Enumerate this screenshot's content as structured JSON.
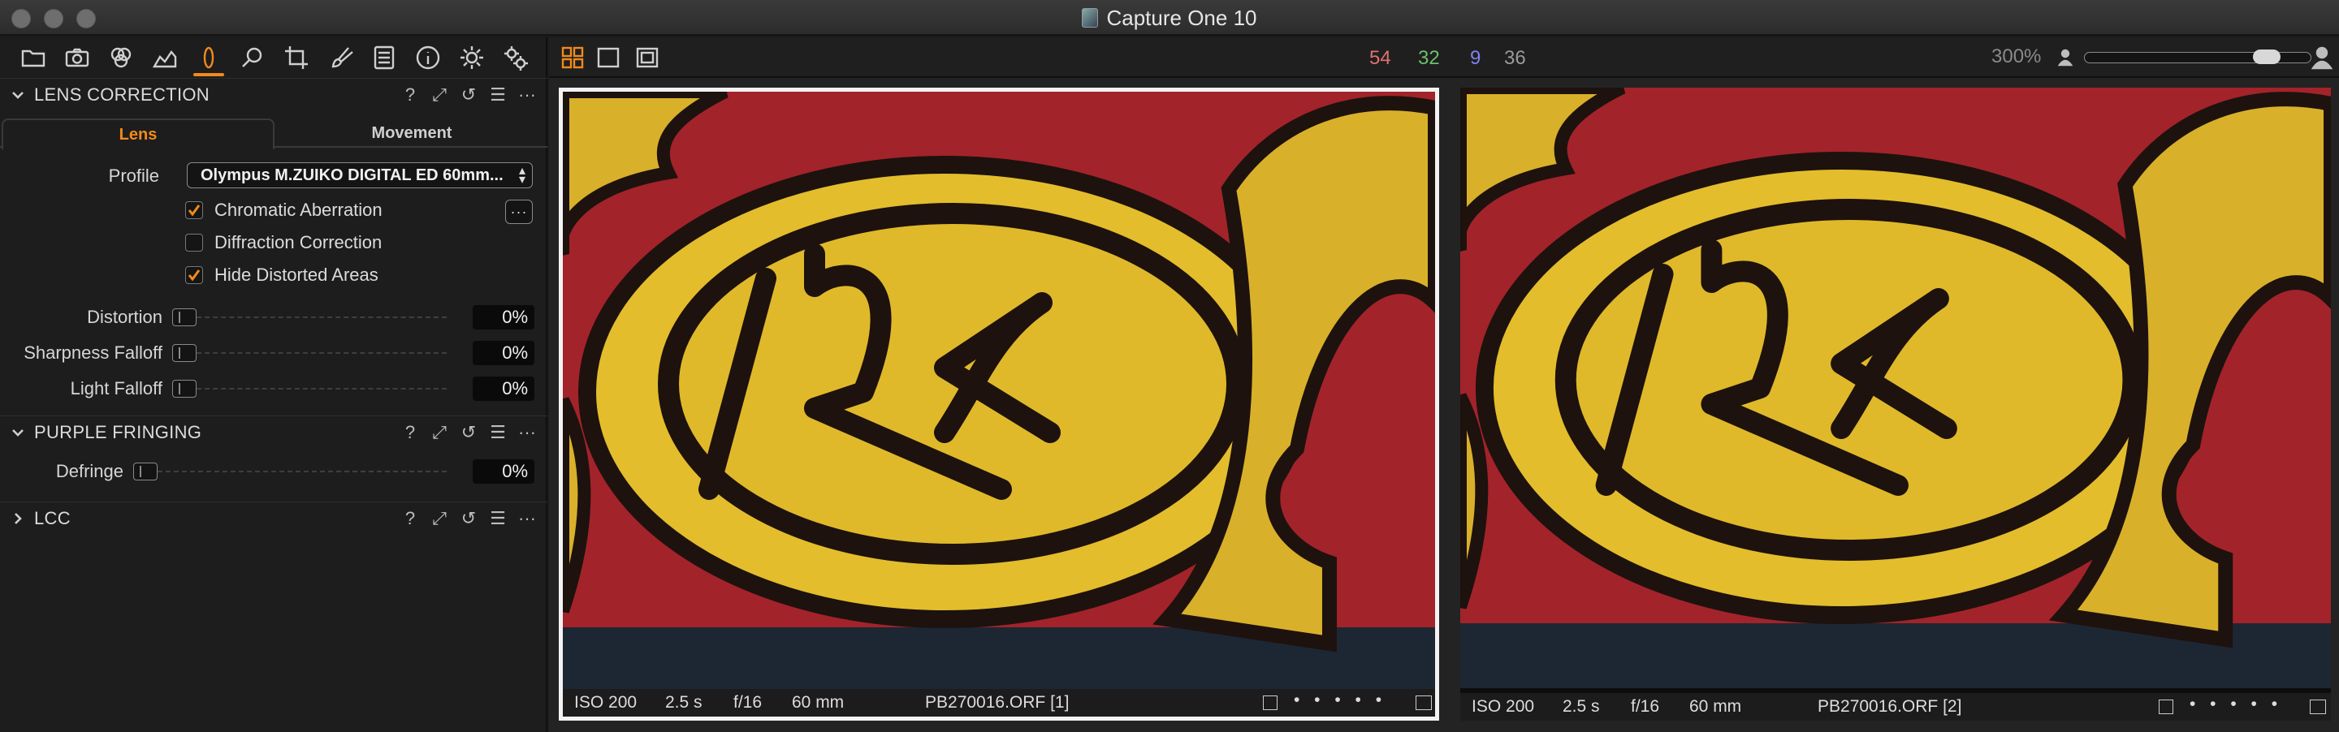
{
  "window": {
    "title": "Capture One 10",
    "colors": {
      "accent": "#f08a1c",
      "background": "#1b1b1b"
    }
  },
  "tool_tabs": [
    {
      "name": "library-icon"
    },
    {
      "name": "camera-icon"
    },
    {
      "name": "color-icon"
    },
    {
      "name": "exposure-icon"
    },
    {
      "name": "lens-icon",
      "active": true
    },
    {
      "name": "focus-icon"
    },
    {
      "name": "crop-icon"
    },
    {
      "name": "brush-icon"
    },
    {
      "name": "output-icon"
    },
    {
      "name": "metadata-icon"
    },
    {
      "name": "settings-icon"
    },
    {
      "name": "batch-icon"
    }
  ],
  "lens_correction": {
    "title": "LENS CORRECTION",
    "tools": [
      "?",
      "⤢",
      "↺",
      "☰",
      "···"
    ],
    "tabs": {
      "lens": "Lens",
      "movement": "Movement"
    },
    "profile_label": "Profile",
    "profile_value": "Olympus M.ZUIKO DIGITAL ED 60mm...",
    "more_label": "···",
    "checks": [
      {
        "label": "Chromatic Aberration",
        "checked": true
      },
      {
        "label": "Diffraction Correction",
        "checked": false
      },
      {
        "label": "Hide Distorted Areas",
        "checked": true
      }
    ],
    "sliders": [
      {
        "label": "Distortion",
        "value": "0%"
      },
      {
        "label": "Sharpness Falloff",
        "value": "0%"
      },
      {
        "label": "Light Falloff",
        "value": "0%"
      }
    ]
  },
  "purple_fringing": {
    "title": "PURPLE FRINGING",
    "slider": {
      "label": "Defringe",
      "value": "0%"
    }
  },
  "lcc": {
    "title": "LCC"
  },
  "viewer": {
    "counts": [
      {
        "value": "54",
        "color": "#e07070"
      },
      {
        "value": "32",
        "color": "#6cc06c"
      },
      {
        "value": "9",
        "color": "#8080ee"
      },
      {
        "value": "36",
        "color": "#9a9a9a"
      }
    ],
    "zoom": "300%",
    "zoom_level": 0.85,
    "images": [
      {
        "iso": "ISO 200",
        "shutter": "2.5 s",
        "aperture": "f/16",
        "focal": "60 mm",
        "filename": "PB270016.ORF [1]",
        "selected": true
      },
      {
        "iso": "ISO 200",
        "shutter": "2.5 s",
        "aperture": "f/16",
        "focal": "60 mm",
        "filename": "PB270016.ORF [2]",
        "selected": false
      }
    ],
    "rating_dots": "• • • • •"
  }
}
